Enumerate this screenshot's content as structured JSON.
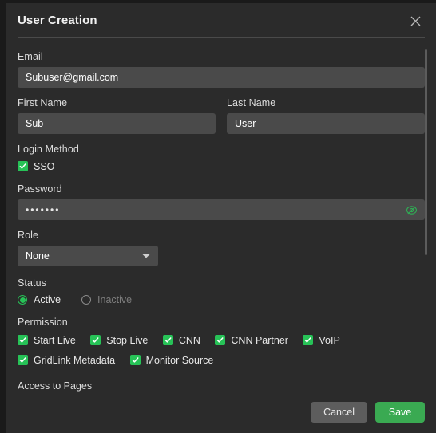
{
  "dialog": {
    "title": "User Creation",
    "close_icon": "close-icon"
  },
  "form": {
    "email": {
      "label": "Email",
      "value": "Subuser@gmail.com",
      "placeholder": "Email"
    },
    "first_name": {
      "label": "First Name",
      "value": "Sub",
      "placeholder": "First Name"
    },
    "last_name": {
      "label": "Last Name",
      "value": "User",
      "placeholder": "Last Name"
    },
    "login_method": {
      "label": "Login Method",
      "options": [
        {
          "label": "SSO",
          "checked": true
        }
      ]
    },
    "password": {
      "label": "Password",
      "value": "•••••••",
      "placeholder": "Password",
      "toggle_icon": "eye-off-icon",
      "toggle_color": "#2faf55"
    },
    "role": {
      "label": "Role",
      "value": "None",
      "caret_icon": "chevron-down-icon"
    },
    "status": {
      "label": "Status",
      "options": [
        {
          "label": "Active",
          "selected": true
        },
        {
          "label": "Inactive",
          "selected": false
        }
      ]
    },
    "permission": {
      "label": "Permission",
      "rows": [
        [
          {
            "label": "Start Live",
            "checked": true
          },
          {
            "label": "Stop Live",
            "checked": true
          },
          {
            "label": "CNN",
            "checked": true
          },
          {
            "label": "CNN Partner",
            "checked": true
          },
          {
            "label": "VoIP",
            "checked": true
          }
        ],
        [
          {
            "label": "GridLink Metadata",
            "checked": true
          },
          {
            "label": "Monitor Source",
            "checked": true
          }
        ]
      ]
    },
    "access_to_pages": {
      "label": "Access to Pages"
    }
  },
  "footer": {
    "cancel_label": "Cancel",
    "save_label": "Save",
    "save_color": "#3aaa52",
    "cancel_color": "#5d5d5d"
  },
  "scrollbar": {
    "name": "vertical-scrollbar"
  }
}
